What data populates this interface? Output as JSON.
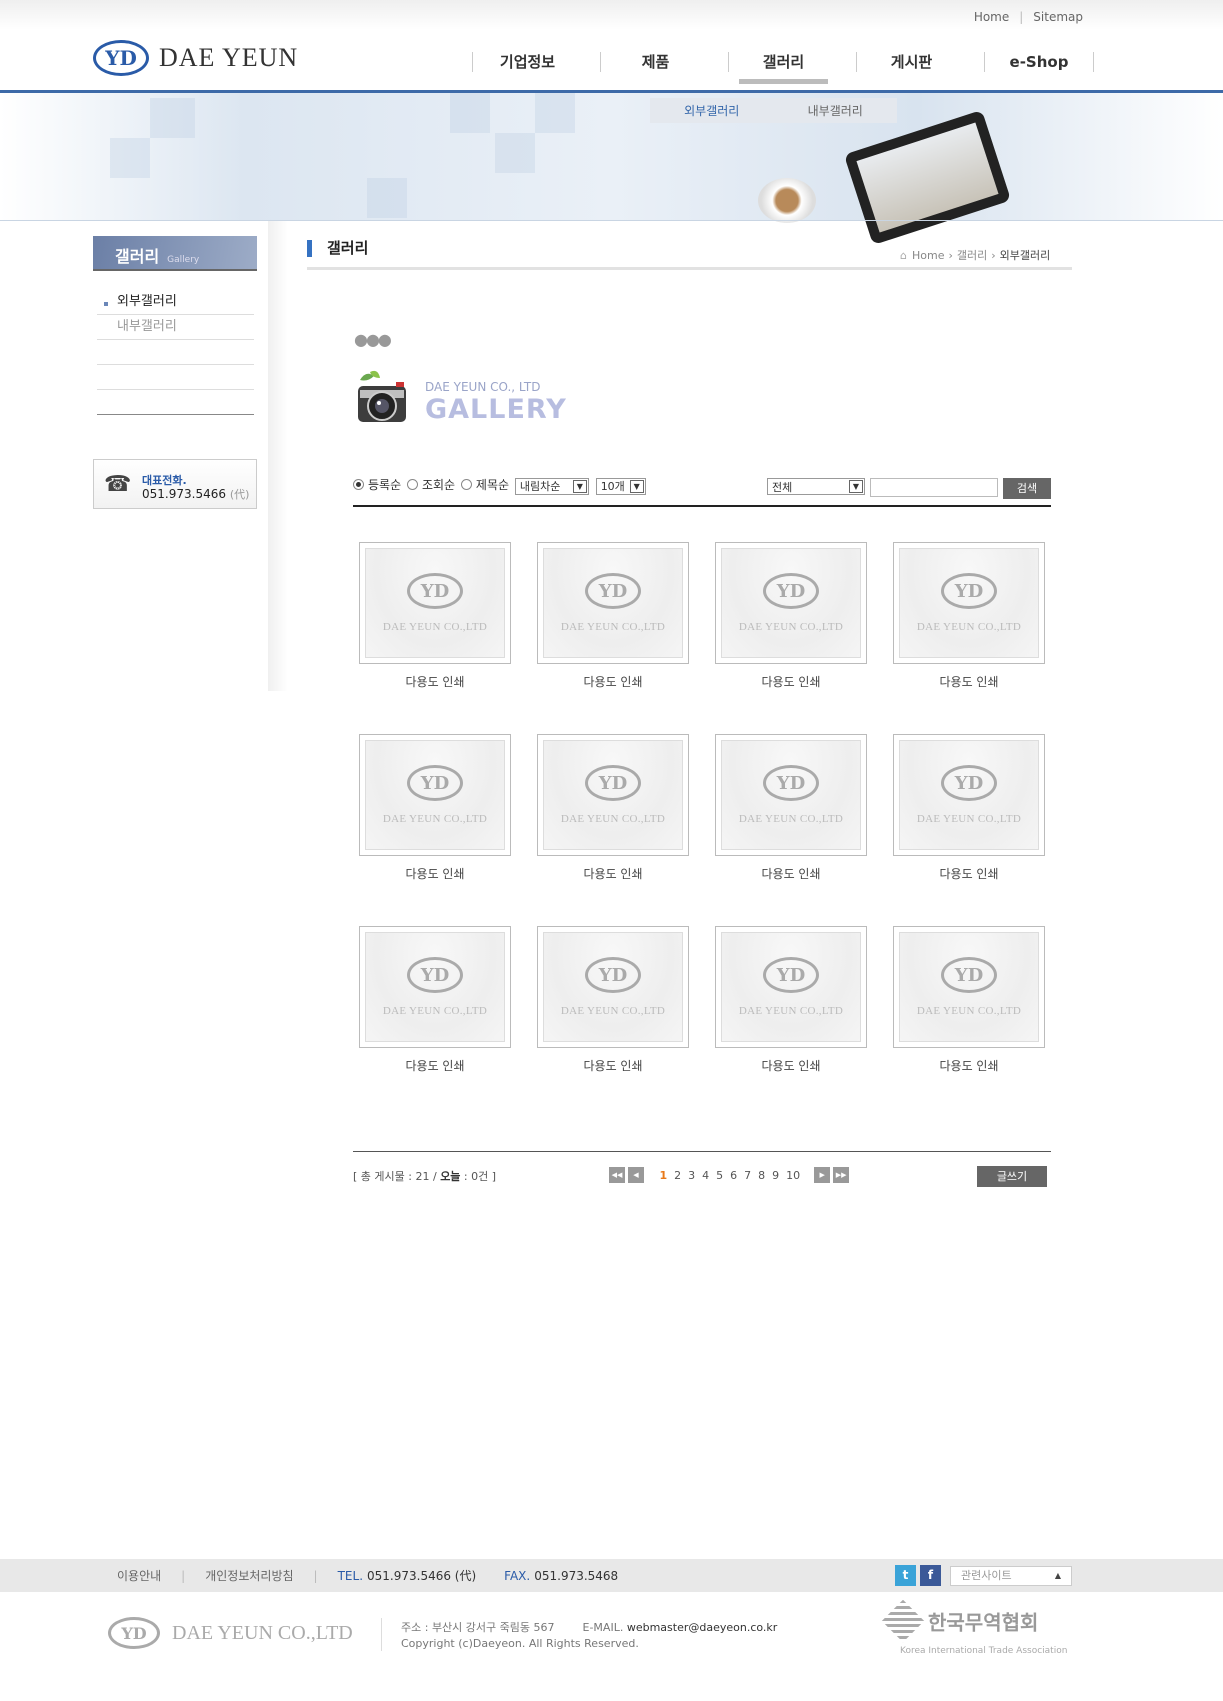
{
  "header": {
    "top_links": [
      "Home",
      "Sitemap"
    ],
    "logo_mark": "YD",
    "logo_text": "DAE YEUN",
    "gnb": [
      "기업정보",
      "제품",
      "갤러리",
      "게시판",
      "e-Shop"
    ],
    "subnav": [
      "외부갤러리",
      "내부갤러리"
    ]
  },
  "sidebar": {
    "title": "갤러리",
    "title_en": "Gallery",
    "items": [
      "외부갤러리",
      "내부갤러리"
    ],
    "call_label": "대표전화.",
    "call_number": "051.973.5466",
    "call_suffix": "(代)"
  },
  "content": {
    "title": "갤러리",
    "breadcrumb": [
      "Home",
      "갤러리",
      "외부갤러리"
    ],
    "gallery_company": "DAE YEUN CO., LTD",
    "gallery_title": "GALLERY"
  },
  "filter": {
    "sort_options": [
      "등록순",
      "조회순",
      "제목순"
    ],
    "selected_sort": "등록순",
    "order": "내림차순",
    "count": "10개",
    "search_field": "전체",
    "search_value": "",
    "search_button": "검색"
  },
  "gallery": {
    "items": [
      {
        "thumb_text": "DAE YEUN CO.,LTD",
        "caption": "다용도 인쇄"
      },
      {
        "thumb_text": "DAE YEUN CO.,LTD",
        "caption": "다용도 인쇄"
      },
      {
        "thumb_text": "DAE YEUN CO.,LTD",
        "caption": "다용도 인쇄"
      },
      {
        "thumb_text": "DAE YEUN CO.,LTD",
        "caption": "다용도 인쇄"
      },
      {
        "thumb_text": "DAE YEUN CO.,LTD",
        "caption": "다용도 인쇄"
      },
      {
        "thumb_text": "DAE YEUN CO.,LTD",
        "caption": "다용도 인쇄"
      },
      {
        "thumb_text": "DAE YEUN CO.,LTD",
        "caption": "다용도 인쇄"
      },
      {
        "thumb_text": "DAE YEUN CO.,LTD",
        "caption": "다용도 인쇄"
      },
      {
        "thumb_text": "DAE YEUN CO.,LTD",
        "caption": "다용도 인쇄"
      },
      {
        "thumb_text": "DAE YEUN CO.,LTD",
        "caption": "다용도 인쇄"
      },
      {
        "thumb_text": "DAE YEUN CO.,LTD",
        "caption": "다용도 인쇄"
      },
      {
        "thumb_text": "DAE YEUN CO.,LTD",
        "caption": "다용도 인쇄"
      }
    ]
  },
  "board": {
    "total_label": "총 게시물",
    "total_value": "21",
    "today_label": "오늘",
    "today_value": "0건",
    "pages": [
      "1",
      "2",
      "3",
      "4",
      "5",
      "6",
      "7",
      "8",
      "9",
      "10"
    ],
    "current_page": "1",
    "write_button": "글쓰기"
  },
  "footer": {
    "links": [
      "이용안내",
      "개인정보처리방침"
    ],
    "tel_label": "TEL.",
    "tel": "051.973.5466 (代)",
    "fax_label": "FAX.",
    "fax": "051.973.5468",
    "related_sites": "관련사이트",
    "company_text": "DAE YEUN CO.,LTD",
    "address": "주소 : 부산시 강서구 죽림동 567",
    "email_label": "E-MAIL.",
    "email": "webmaster@daeyeon.co.kr",
    "copyright": "Copyright (c)Daeyeon. All Rights Reserved.",
    "kita_name": "한국무역협회",
    "kita_en": "Korea International Trade Association"
  },
  "colors": {
    "accent": "#2a5ba8",
    "active_page": "#e8791a",
    "button": "#666666"
  }
}
